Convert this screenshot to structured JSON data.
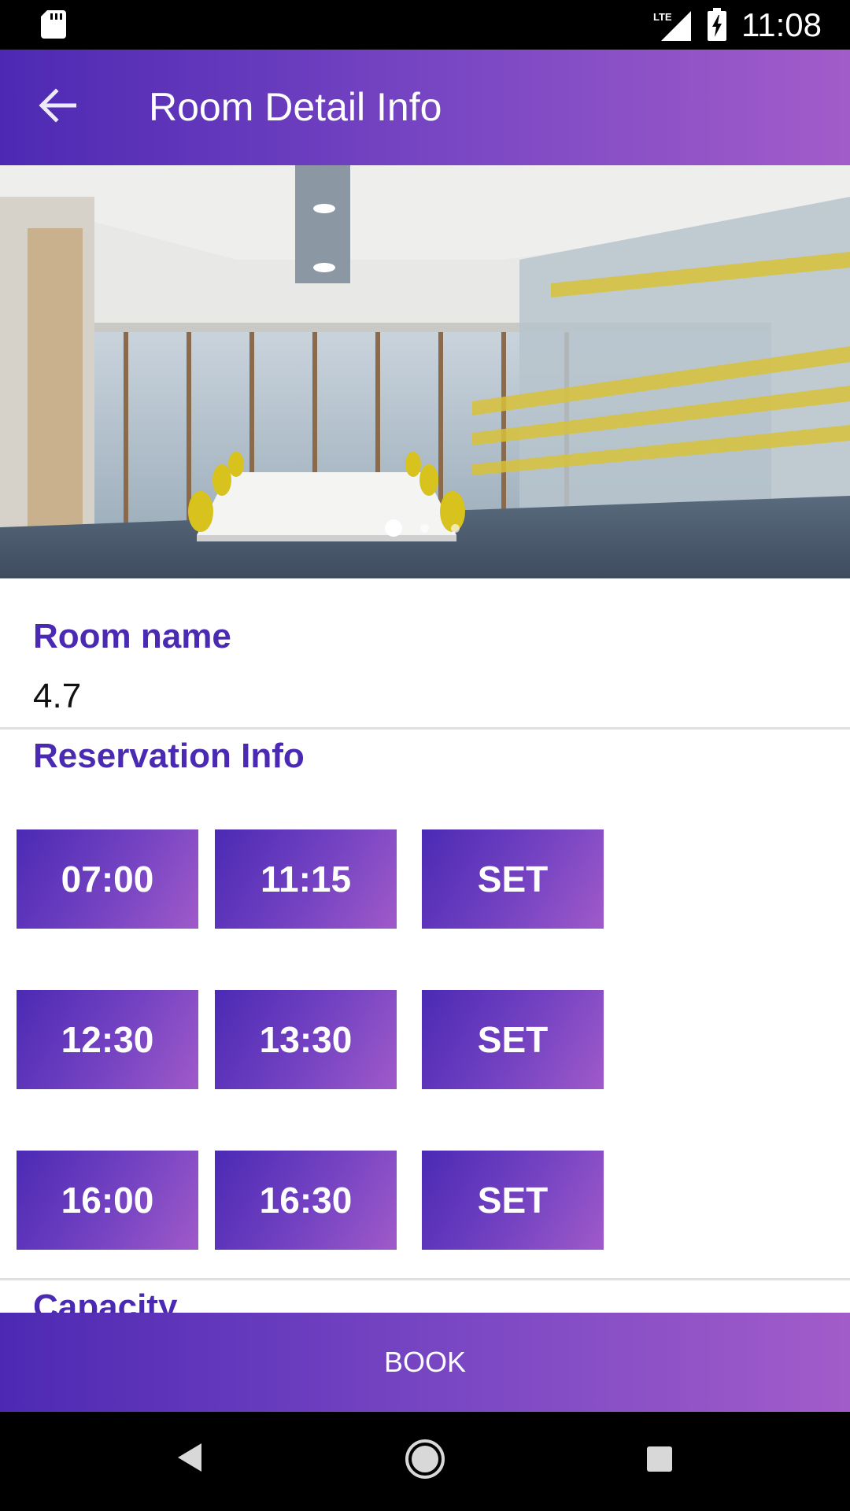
{
  "status_bar": {
    "time": "11:08",
    "network_label": "LTE",
    "icons": [
      "sd-card-icon",
      "lte-signal-icon",
      "battery-charging-icon"
    ]
  },
  "app_bar": {
    "title": "Room Detail Info",
    "back_icon": "arrow-back-icon"
  },
  "carousel": {
    "image_alt": "conference room photo",
    "page_count": 3,
    "active_page": 1
  },
  "room": {
    "label": "Room name",
    "value": "4.7"
  },
  "reservation": {
    "label": "Reservation Info",
    "rows": [
      {
        "start": "07:00",
        "end": "11:15",
        "action": "SET"
      },
      {
        "start": "12:30",
        "end": "13:30",
        "action": "SET"
      },
      {
        "start": "16:00",
        "end": "16:30",
        "action": "SET"
      }
    ]
  },
  "capacity": {
    "label": "Capacity"
  },
  "book_button": {
    "label": "BOOK"
  },
  "nav_bar": {
    "icons": [
      "nav-back-icon",
      "nav-home-icon",
      "nav-recent-icon"
    ]
  },
  "colors": {
    "accent": "#4a2ab3",
    "gradient_start": "#4d29b3",
    "gradient_end": "#a25cc9"
  }
}
